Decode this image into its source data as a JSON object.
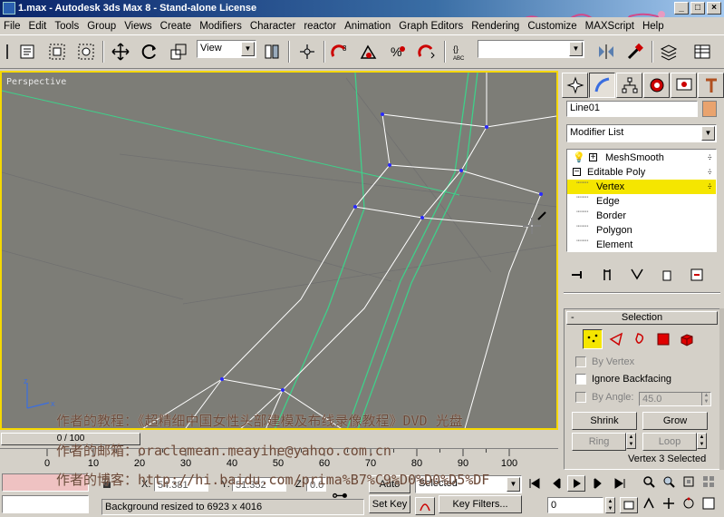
{
  "window": {
    "title": "1.max - Autodesk 3ds Max 8  - Stand-alone License",
    "buttons": {
      "minimize": "_",
      "maximize": "□",
      "close": "×"
    }
  },
  "menu": [
    "File",
    "Edit",
    "Tools",
    "Group",
    "Views",
    "Create",
    "Modifiers",
    "Character",
    "reactor",
    "Animation",
    "Graph Editors",
    "Rendering",
    "Customize",
    "MAXScript",
    "Help"
  ],
  "toolbar": {
    "refcoord_value": "View",
    "named_selection_value": ""
  },
  "viewport": {
    "label": "Perspective",
    "axis_z": "z",
    "axis_x": "x",
    "border_color": "#f5d800",
    "background_color": "#7d7d77"
  },
  "command_panel": {
    "object_name": "Line01",
    "object_color": "#e9a36e",
    "modifier_list_label": "Modifier List",
    "stack": [
      {
        "label": "MeshSmooth",
        "level": 0
      },
      {
        "label": "Editable Poly",
        "level": 0
      },
      {
        "label": "Vertex",
        "level": 1,
        "selected": true
      },
      {
        "label": "Edge",
        "level": 1
      },
      {
        "label": "Border",
        "level": 1
      },
      {
        "label": "Polygon",
        "level": 1
      },
      {
        "label": "Element",
        "level": 1
      }
    ],
    "selection": {
      "title": "Selection",
      "by_vertex": "By Vertex",
      "ignore_backfacing": "Ignore Backfacing",
      "by_angle": "By Angle:",
      "angle_value": "45.0",
      "shrink": "Shrink",
      "grow": "Grow",
      "ring": "Ring",
      "loop": "Loop",
      "status": "Vertex 3 Selected"
    }
  },
  "timeline": {
    "slider_label": "0 / 100",
    "ticks": [
      "0",
      "10",
      "20",
      "30",
      "40",
      "50",
      "60",
      "70",
      "80",
      "90",
      "100"
    ]
  },
  "statusbar": {
    "x_label": "X:",
    "x_value": "54.381",
    "y_label": "Y:",
    "y_value": "51.352",
    "z_label": "Z:",
    "z_value": "0.0",
    "auto_key": "Auto Key",
    "set_key": "Set Key",
    "selected_value": "Selected",
    "key_filters": "Key Filters...",
    "frame_value": "0",
    "prompt": "Background resized to 6923 x 4016"
  },
  "watermark": {
    "line1": "作者的教程：《超精细中国女性头部建模及布线录像教程》DVD 光盘",
    "line2": "作者的邮箱：oraclemean.meayihe@yahoo.com.cn",
    "line3": "作者的博客：http://hi.baidu.com/prima%B7%C9%D0%D0%D5%DF"
  }
}
